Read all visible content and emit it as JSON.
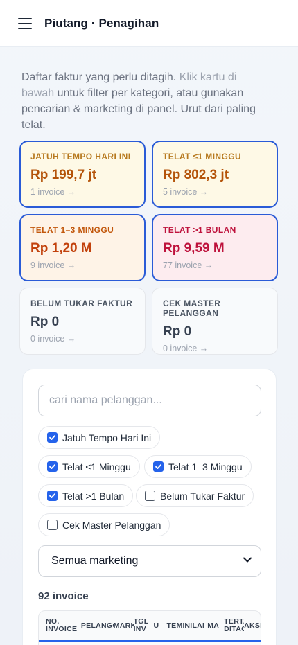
{
  "header": {
    "title": "Piutang · Penagihan"
  },
  "intro": {
    "text1": "Daftar faktur yang perlu ditagih. ",
    "hint": "Klik kartu di bawah",
    "text2": " untuk filter per kategori, atau gunakan pencarian & marketing di panel. Urut dari paling telat."
  },
  "cards": [
    {
      "label": "JATUH TEMPO HARI INI",
      "amount": "Rp 199,7 jt",
      "count": "1 invoice →",
      "active": true,
      "bg": "#fef9e6",
      "label_color": "#b7791f",
      "amount_color": "#b45309"
    },
    {
      "label": "TELAT ≤1 MINGGU",
      "amount": "Rp 802,3 jt",
      "count": "5 invoice →",
      "active": true,
      "bg": "#fef9e6",
      "label_color": "#b7791f",
      "amount_color": "#b45309"
    },
    {
      "label": "TELAT 1–3 MINGGU",
      "amount": "Rp 1,20 M",
      "count": "9 invoice →",
      "active": true,
      "bg": "#fef3e7",
      "label_color": "#c2570c",
      "amount_color": "#c2410c"
    },
    {
      "label": "TELAT >1 BULAN",
      "amount": "Rp 9,59 M",
      "count": "77 invoice →",
      "active": true,
      "bg": "#fdecef",
      "label_color": "#be123c",
      "amount_color": "#be123c"
    },
    {
      "label": "BELUM TUKAR FAKTUR",
      "amount": "Rp 0",
      "count": "0 invoice →",
      "active": false,
      "bg": "#f8fafc",
      "label_color": "#4b5563",
      "amount_color": "#374151"
    },
    {
      "label": "CEK MASTER PELANGGAN",
      "amount": "Rp 0",
      "count": "0 invoice →",
      "active": false,
      "bg": "#f8fafc",
      "label_color": "#4b5563",
      "amount_color": "#374151"
    }
  ],
  "search": {
    "placeholder": "cari nama pelanggan...",
    "value": ""
  },
  "filters": [
    {
      "label": "Jatuh Tempo Hari Ini",
      "checked": true
    },
    {
      "label": "Telat ≤1 Minggu",
      "checked": true
    },
    {
      "label": "Telat 1–3 Minggu",
      "checked": true
    },
    {
      "label": "Telat >1 Bulan",
      "checked": true
    },
    {
      "label": "Belum Tukar Faktur",
      "checked": false
    },
    {
      "label": "Cek Master Pelanggan",
      "checked": false
    }
  ],
  "marketing": {
    "selected": "Semua marketing"
  },
  "summary": {
    "count": "92 invoice"
  },
  "table": {
    "columns": [
      "NO. INVOICE",
      "PELANGGAN",
      "MARKETING",
      "TGL INV",
      "U",
      "TEMPO",
      "NILAI",
      "MA",
      "TERTAGIH DITAGIH",
      "AKSI"
    ]
  },
  "colors": {
    "accent": "#2563eb",
    "active_border": "#2a5bd7"
  }
}
